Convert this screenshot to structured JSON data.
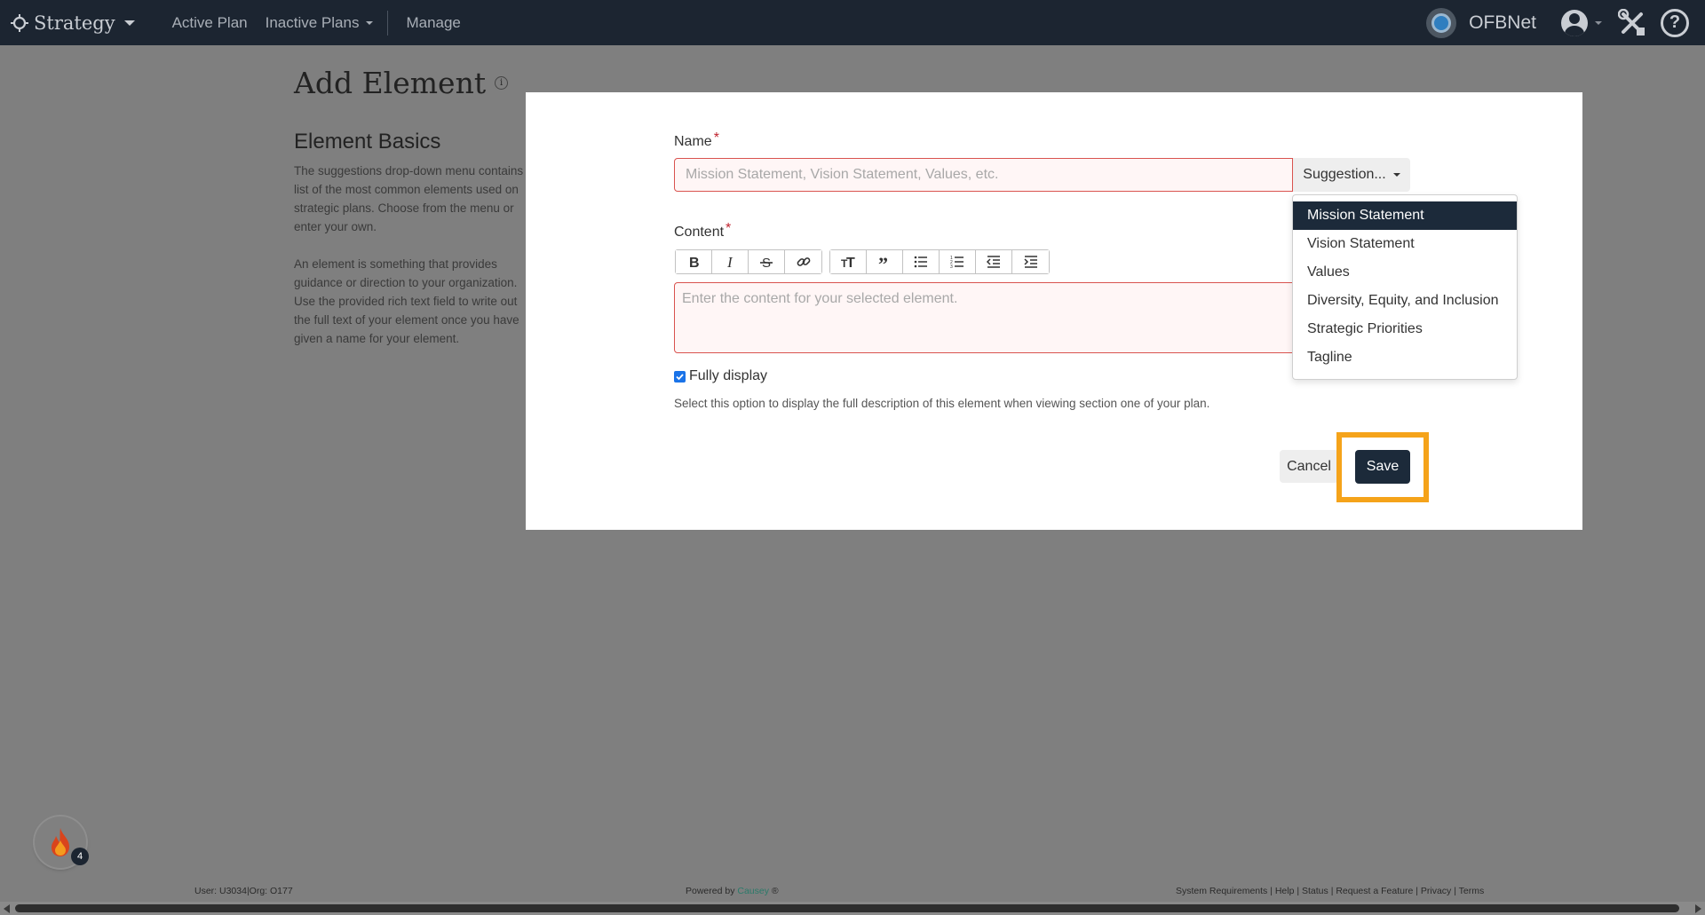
{
  "navbar": {
    "brand": "Strategy",
    "links": [
      "Active Plan",
      "Inactive Plans",
      "Manage"
    ],
    "org_name": "OFBNet",
    "help_symbol": "?"
  },
  "page": {
    "title": "Add Element",
    "info_symbol": "i",
    "section_heading": "Element Basics",
    "paragraph1": [
      "The suggestions drop-down menu contains a",
      "list of the most common elements used on",
      "strategic plans. Choose from the menu or",
      "enter your own."
    ],
    "paragraph2": [
      "An element is something that provides",
      "guidance or direction to your organization.",
      "Use the provided rich text field to write out",
      "the full text of your element once you have",
      "given a name for your element."
    ]
  },
  "modal": {
    "name_label": "Name",
    "required_mark": "*",
    "name_placeholder": "Mission Statement, Vision Statement, Values, etc.",
    "suggestion_label": "Suggestion...",
    "suggestions": [
      "Mission Statement",
      "Vision Statement",
      "Values",
      "Diversity, Equity, and Inclusion",
      "Strategic Priorities",
      "Tagline"
    ],
    "content_label": "Content",
    "content_placeholder": "Enter the content for your selected element.",
    "toolbar_icons": [
      "bold-icon",
      "italic-icon",
      "strikethrough-icon",
      "link-icon",
      "heading-icon",
      "quote-icon",
      "bullet-list-icon",
      "numbered-list-icon",
      "outdent-icon",
      "indent-icon"
    ],
    "fully_display_label": "Fully display",
    "fully_display_checked": true,
    "help_text": "Select this option to display the full description of this element when viewing section one of your plan.",
    "cancel_label": "Cancel",
    "save_label": "Save"
  },
  "notifications": {
    "count": "4"
  },
  "footer": {
    "user": "User: U3034|Org: O177",
    "powered_by": "Powered by",
    "powered_brand": "Causey",
    "registered": "®",
    "links": "System Requirements | Help | Status | Request a Feature | Privacy | Terms"
  },
  "colors": {
    "navbar": "#1c2531",
    "primary_button": "#1c2a3a",
    "highlight": "#f5a31a",
    "error_border": "#d9534f"
  }
}
